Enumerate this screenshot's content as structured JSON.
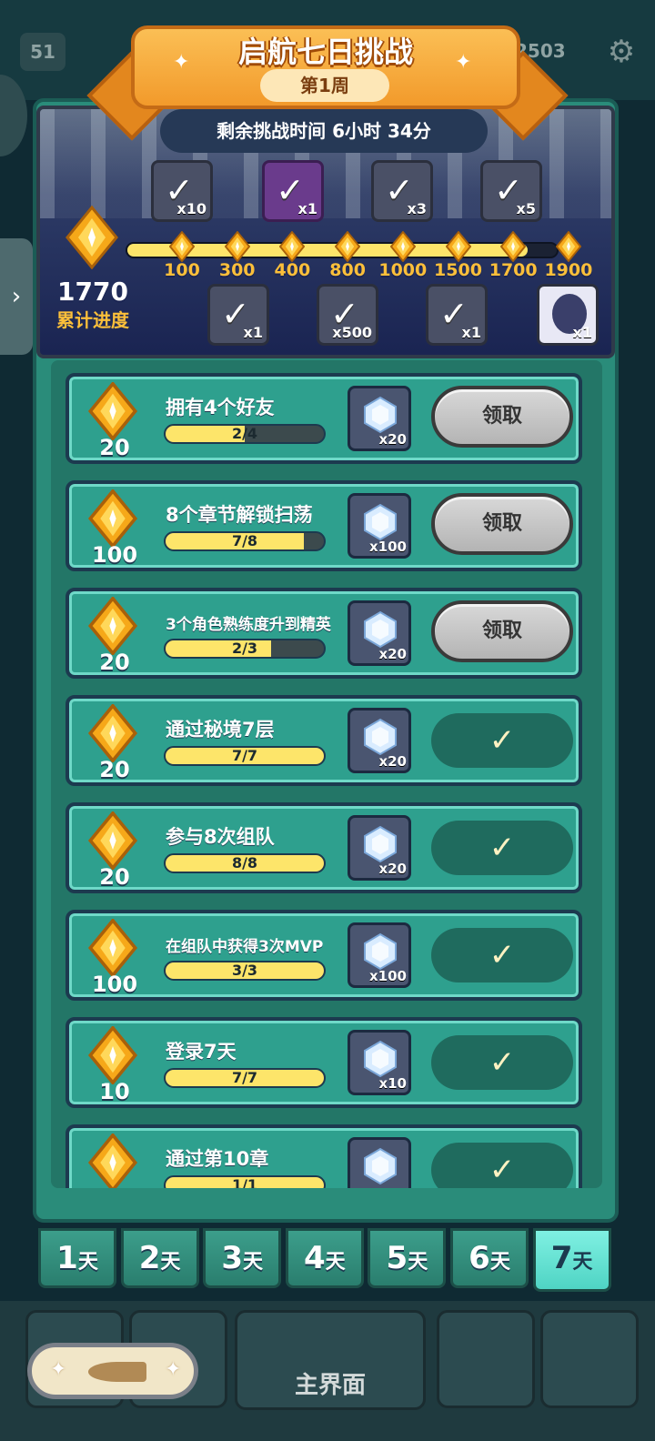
{
  "header": {
    "level": "51",
    "gold": "2503",
    "gear_icon": "gear-icon"
  },
  "banner": {
    "title": "启航七日挑战",
    "week": "第1周",
    "time_left": "剩余挑战时间 6小时 34分"
  },
  "progress": {
    "total_points": "1770",
    "total_label": "累计进度",
    "max": 1900,
    "current": 1770,
    "milestones": [
      {
        "value": "100"
      },
      {
        "value": "300"
      },
      {
        "value": "400"
      },
      {
        "value": "800"
      },
      {
        "value": "1000"
      },
      {
        "value": "1500"
      },
      {
        "value": "1700"
      },
      {
        "value": "1900"
      }
    ],
    "top_rewards": [
      {
        "count": "x10",
        "claimed": true,
        "style": "grey"
      },
      {
        "count": "x1",
        "claimed": true,
        "style": "purple"
      },
      {
        "count": "x3",
        "claimed": true,
        "style": "grey"
      },
      {
        "count": "x5",
        "claimed": true,
        "style": "grey"
      }
    ],
    "bottom_rewards": [
      {
        "count": "x1",
        "claimed": true,
        "style": "grey"
      },
      {
        "count": "x500",
        "claimed": true,
        "style": "grey"
      },
      {
        "count": "x1",
        "claimed": true,
        "style": "grey"
      },
      {
        "count": "x1",
        "claimed": false,
        "style": "hero"
      }
    ]
  },
  "tasks": [
    {
      "points": "20",
      "name": "拥有4个好友",
      "progress": "2/4",
      "fraction": 0.5,
      "reward": "x20",
      "claim": "领取",
      "done": false,
      "small": false
    },
    {
      "points": "100",
      "name": "8个章节解锁扫荡",
      "progress": "7/8",
      "fraction": 0.875,
      "reward": "x100",
      "claim": "领取",
      "done": false,
      "small": false
    },
    {
      "points": "20",
      "name": "3个角色熟练度升到精英",
      "progress": "2/3",
      "fraction": 0.667,
      "reward": "x20",
      "claim": "领取",
      "done": false,
      "small": true
    },
    {
      "points": "20",
      "name": "通过秘境7层",
      "progress": "7/7",
      "fraction": 1,
      "reward": "x20",
      "claim": "",
      "done": true,
      "small": false
    },
    {
      "points": "20",
      "name": "参与8次组队",
      "progress": "8/8",
      "fraction": 1,
      "reward": "x20",
      "claim": "",
      "done": true,
      "small": false
    },
    {
      "points": "100",
      "name": "在组队中获得3次MVP",
      "progress": "3/3",
      "fraction": 1,
      "reward": "x100",
      "claim": "",
      "done": true,
      "small": true
    },
    {
      "points": "10",
      "name": "登录7天",
      "progress": "7/7",
      "fraction": 1,
      "reward": "x10",
      "claim": "",
      "done": true,
      "small": false
    },
    {
      "points": "",
      "name": "通过第10章",
      "progress": "1/1",
      "fraction": 1,
      "reward": "",
      "claim": "",
      "done": true,
      "small": false
    }
  ],
  "days": [
    {
      "num": "1",
      "unit": "天"
    },
    {
      "num": "2",
      "unit": "天"
    },
    {
      "num": "3",
      "unit": "天"
    },
    {
      "num": "4",
      "unit": "天"
    },
    {
      "num": "5",
      "unit": "天"
    },
    {
      "num": "6",
      "unit": "天"
    },
    {
      "num": "7",
      "unit": "天"
    }
  ],
  "active_day": 6,
  "bottom_nav": {
    "main_label": "主界面"
  },
  "colors": {
    "gold": "#fbbf3a",
    "panel": "#2a8c7a",
    "banner": "#f29a2b"
  }
}
